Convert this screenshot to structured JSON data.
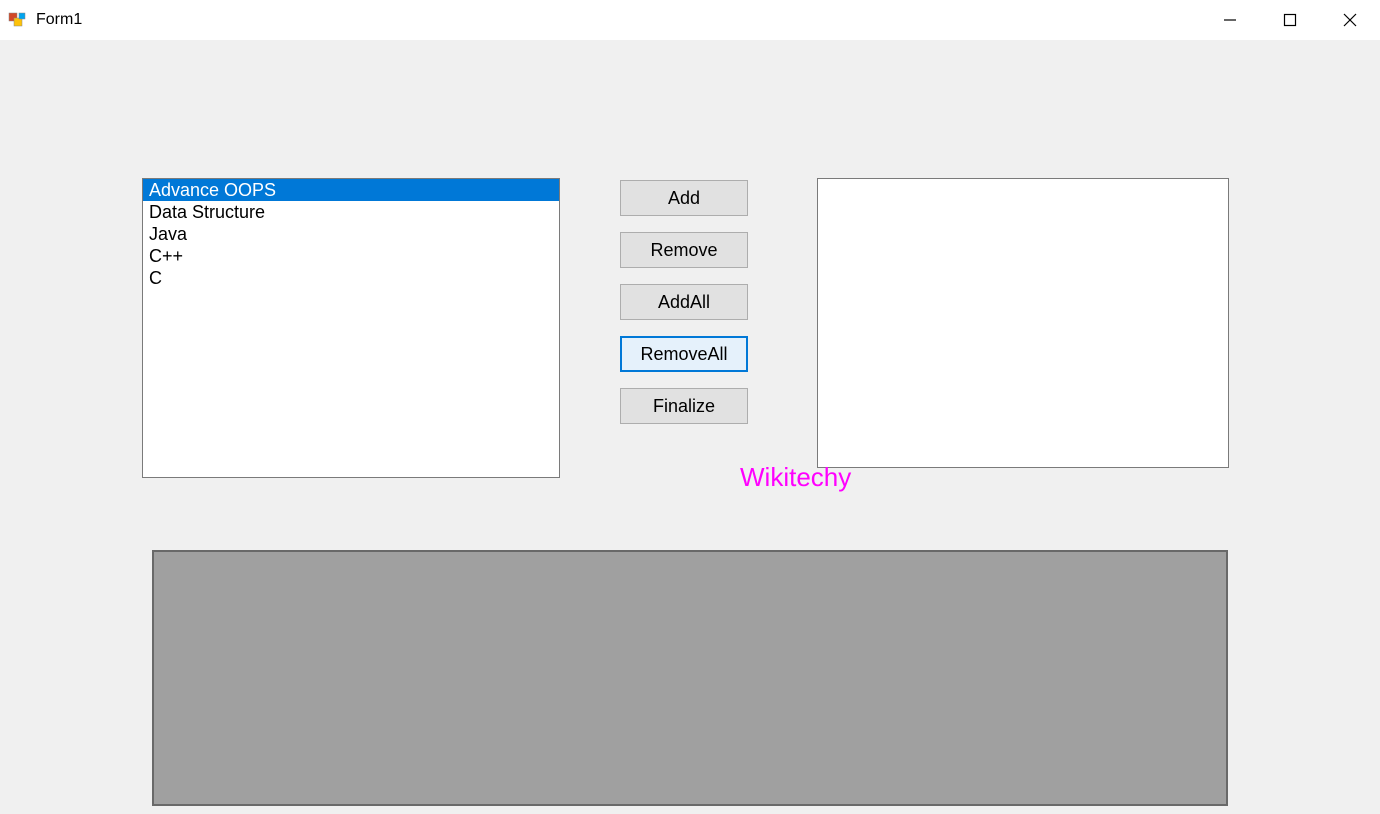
{
  "window": {
    "title": "Form1"
  },
  "listbox_left": {
    "items": [
      "Advance OOPS",
      "Data Structure",
      "Java",
      "C++",
      "C"
    ],
    "selected_index": 0
  },
  "listbox_right": {
    "items": []
  },
  "buttons": {
    "add": "Add",
    "remove": "Remove",
    "addall": "AddAll",
    "removeall": "RemoveAll",
    "finalize": "Finalize",
    "focused": "removeall"
  },
  "watermark": "Wikitechy"
}
